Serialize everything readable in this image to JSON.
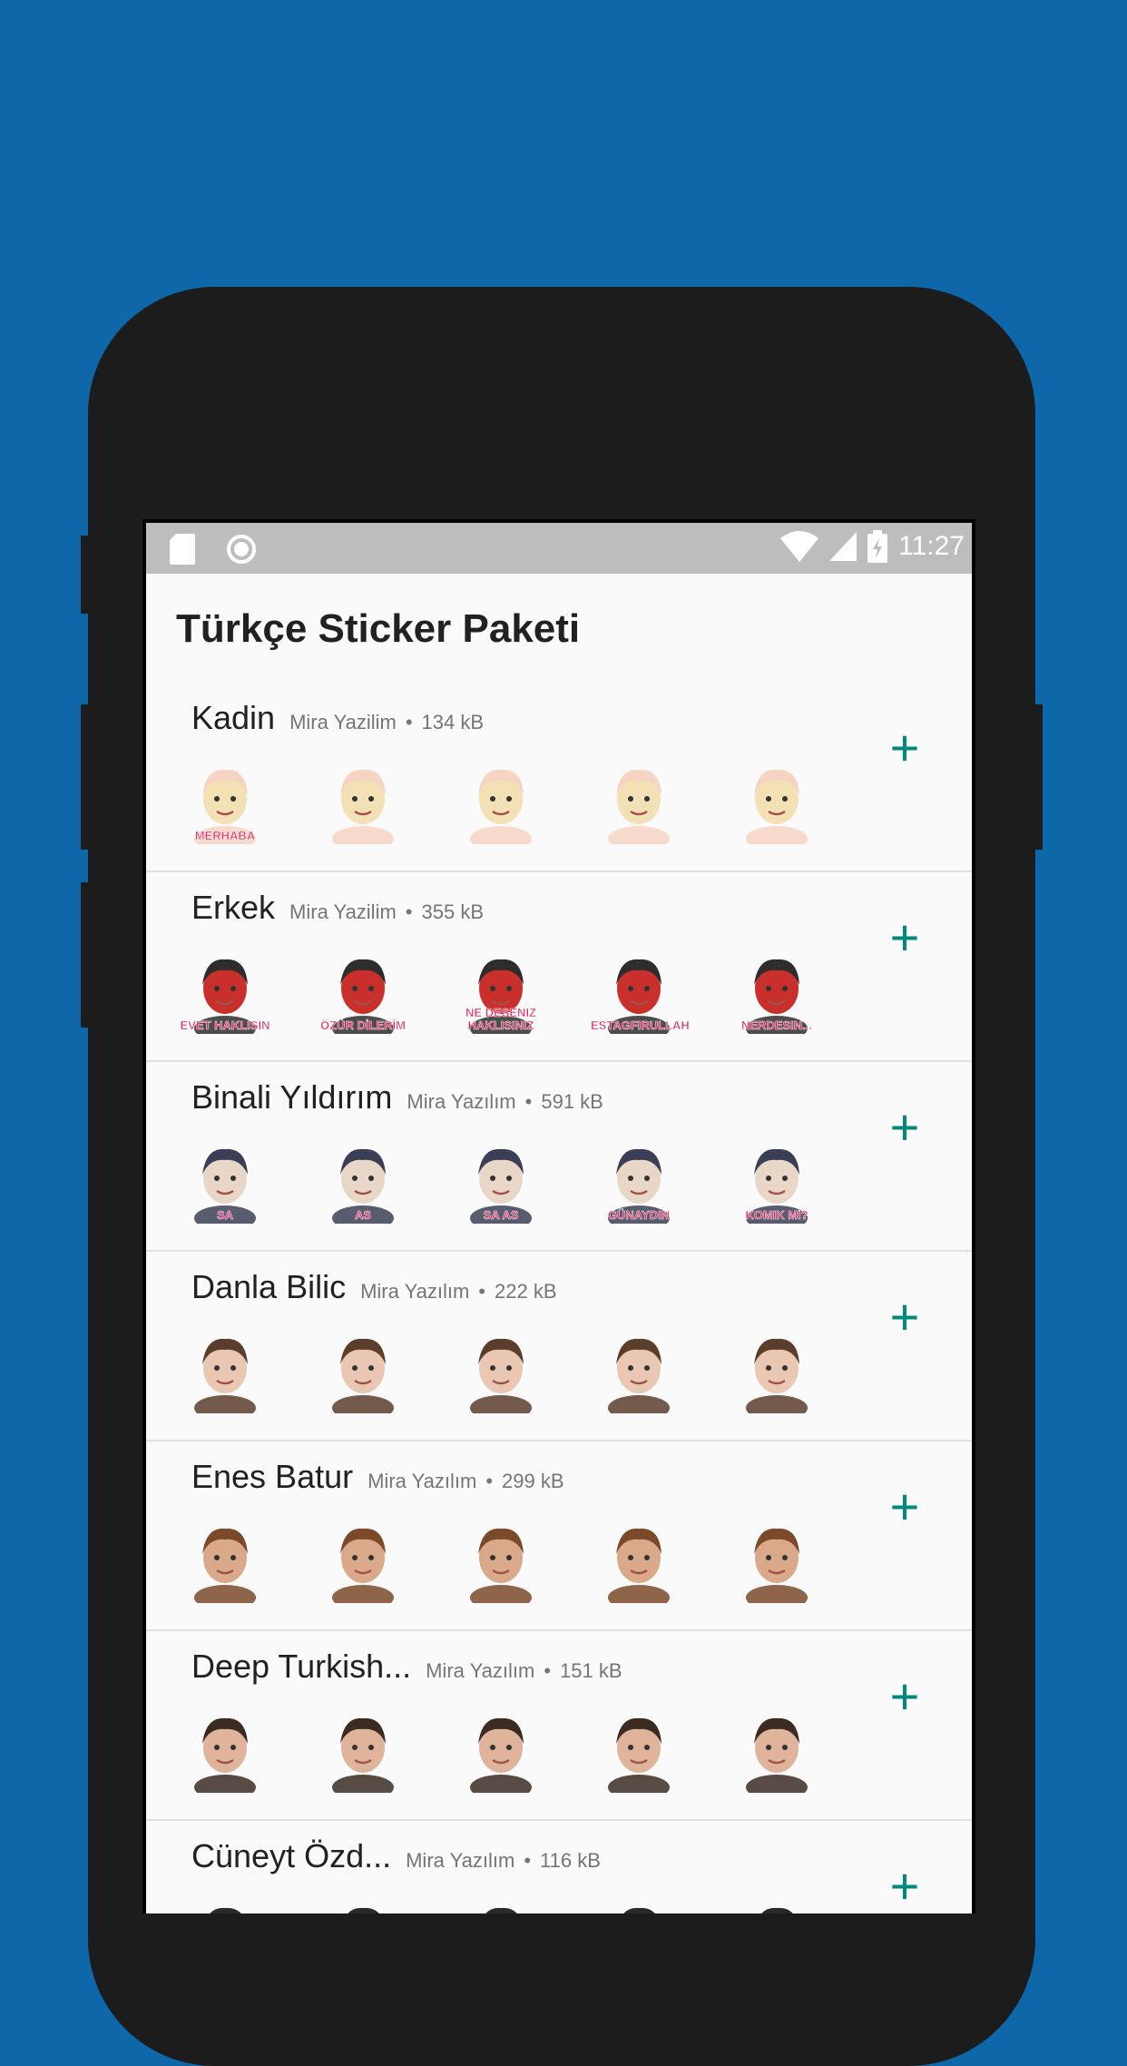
{
  "status_bar": {
    "time": "11:27",
    "icons": [
      "sd-card-icon",
      "circle-notification-icon",
      "wifi-icon",
      "signal-icon",
      "battery-charging-icon"
    ]
  },
  "app": {
    "title": "Türkçe Sticker Paketi"
  },
  "packs": [
    {
      "name": "Kadin",
      "publisher": "Mira Yazilim",
      "size": "134 kB",
      "captions": [
        "MERHABA",
        "",
        "",
        "",
        ""
      ]
    },
    {
      "name": "Erkek",
      "publisher": "Mira Yazilim",
      "size": "355 kB",
      "captions": [
        "EVET HAKLISIN",
        "ÖZÜR DİLERİM",
        "NE DESENIZ HAKLISINIZ",
        "ESTAGFIRULLAH",
        "NERDESIN..."
      ]
    },
    {
      "name": "Binali Yıldırım",
      "publisher": "Mira Yazılım",
      "size": "591 kB",
      "captions": [
        "SA",
        "AS",
        "SA AS",
        "GÜNAYDIN",
        "KOMIK Mİ?"
      ]
    },
    {
      "name": "Danla Bilic",
      "publisher": "Mira Yazılım",
      "size": "222 kB",
      "captions": [
        "",
        "",
        "",
        "",
        ""
      ]
    },
    {
      "name": "Enes Batur",
      "publisher": "Mira Yazılım",
      "size": "299 kB",
      "captions": [
        "",
        "",
        "",
        "",
        ""
      ]
    },
    {
      "name": "Deep Turkish...",
      "publisher": "Mira Yazılım",
      "size": "151 kB",
      "captions": [
        "",
        "",
        "",
        "",
        ""
      ]
    },
    {
      "name": "Cüneyt Özd...",
      "publisher": "Mira Yazılım",
      "size": "116 kB",
      "captions": [
        "",
        "",
        "",
        "",
        ""
      ]
    }
  ],
  "add_label": "+",
  "colors": {
    "background": "#0d67a9",
    "accent": "#00897b",
    "status_bar": "#bdbdbd"
  }
}
